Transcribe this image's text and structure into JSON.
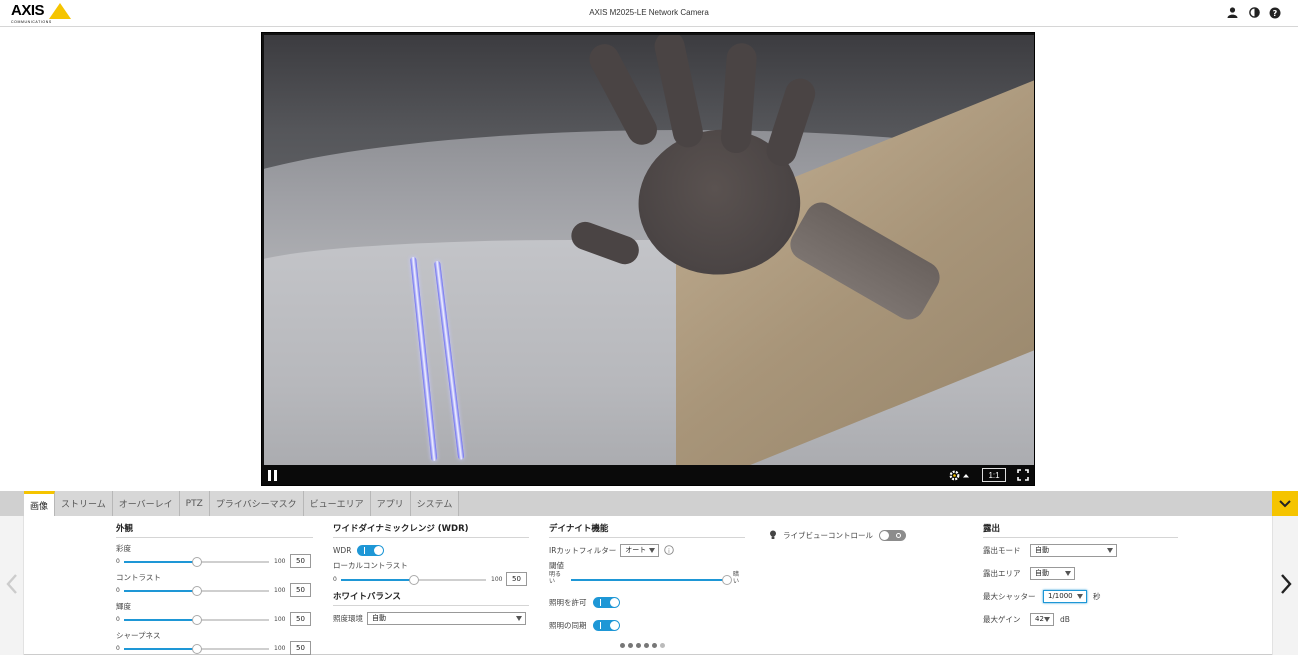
{
  "header": {
    "brand": "AXIS",
    "brand_sub": "COMMUNICATIONS",
    "title": "AXIS M2025-LE Network Camera",
    "icons": [
      "user-icon",
      "contrast-icon",
      "help-icon"
    ]
  },
  "video": {
    "zoom_label": "1:1",
    "controls": [
      "pause-icon",
      "stream-settings-icon",
      "fullscreen-icon"
    ]
  },
  "tabs": [
    "画像",
    "ストリーム",
    "オーバーレイ",
    "PTZ",
    "プライバシーマスク",
    "ビューエリア",
    "アプリ",
    "システム"
  ],
  "active_tab": "画像",
  "appearance": {
    "title": "外観",
    "sliders": [
      {
        "label": "彩度",
        "min": "0",
        "max": "100",
        "value": "50",
        "fraction": 0.5
      },
      {
        "label": "コントラスト",
        "min": "0",
        "max": "100",
        "value": "50",
        "fraction": 0.5
      },
      {
        "label": "輝度",
        "min": "0",
        "max": "100",
        "value": "50",
        "fraction": 0.5
      },
      {
        "label": "シャープネス",
        "min": "0",
        "max": "100",
        "value": "50",
        "fraction": 0.5
      }
    ]
  },
  "wdr": {
    "title": "ワイドダイナミックレンジ (WDR)",
    "wdr_label": "WDR",
    "local_contrast_label": "ローカルコントラスト",
    "local_contrast": {
      "min": "0",
      "max": "100",
      "value": "50",
      "fraction": 0.5
    }
  },
  "white_balance": {
    "title": "ホワイトバランス",
    "env_label": "照度環境",
    "env_value": "自動"
  },
  "day_night": {
    "title": "デイナイト機能",
    "ir_filter_label": "IRカットフィルター",
    "ir_filter_value": "オート",
    "threshold_label": "閾値",
    "threshold_left": "明る\nい",
    "threshold_right": "暗\nい",
    "threshold_fraction": 1.0,
    "allow_light_label": "照明を許可",
    "sync_light_label": "照明の同期"
  },
  "live_view": {
    "label": "ライブビューコントロール"
  },
  "exposure": {
    "title": "露出",
    "mode_label": "露出モード",
    "mode_value": "自動",
    "area_label": "露出エリア",
    "area_value": "自動",
    "shutter_label": "最大シャッター",
    "shutter_value": "1/1000",
    "shutter_unit": "秒",
    "gain_label": "最大ゲイン",
    "gain_value": "42",
    "gain_unit": "dB"
  },
  "pagination": {
    "total": 6,
    "current": 0
  }
}
